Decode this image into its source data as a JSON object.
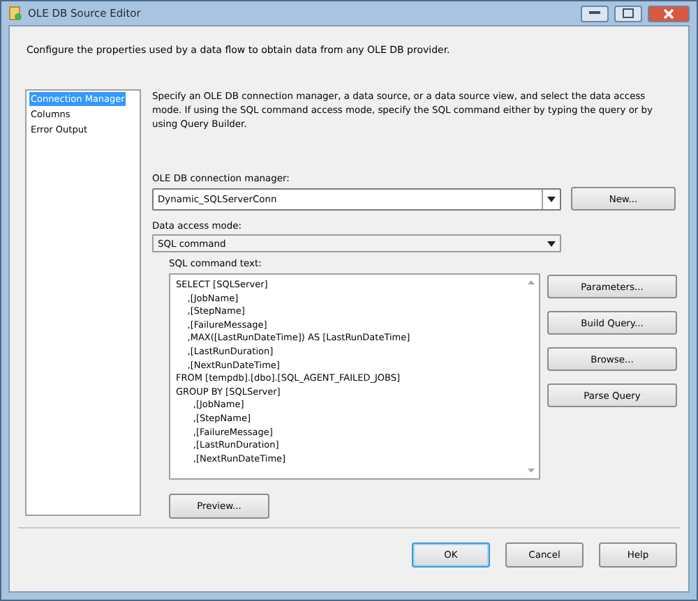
{
  "window": {
    "title": "OLE DB Source Editor"
  },
  "description": "Configure the properties used by a data flow to obtain data from any OLE DB provider.",
  "sidebar": {
    "items": [
      {
        "label": "Connection Manager",
        "selected": true
      },
      {
        "label": "Columns",
        "selected": false
      },
      {
        "label": "Error Output",
        "selected": false
      }
    ]
  },
  "page": {
    "instructions": "Specify an OLE DB connection manager, a data source, or a data source view, and select the data access mode. If using the SQL command access mode, specify the SQL command either by typing the query or by using Query Builder.",
    "connection_label": "OLE DB connection manager:",
    "connection_value": "Dynamic_SQLServerConn",
    "new_button": "New...",
    "mode_label": "Data access mode:",
    "mode_value": "SQL command",
    "sql_label": "SQL command text:",
    "sql_lines": [
      "SELECT [SQLServer]",
      "    ,[JobName]",
      "    ,[StepName]",
      "    ,[FailureMessage]",
      "    ,MAX([LastRunDateTime]) AS [LastRunDateTime]",
      "    ,[LastRunDuration]",
      "    ,[NextRunDateTime]",
      "FROM [tempdb].[dbo].[SQL_AGENT_FAILED_JOBS]",
      "GROUP BY [SQLServer]",
      "      ,[JobName]",
      "      ,[StepName]",
      "      ,[FailureMessage]",
      "      ,[LastRunDuration]",
      "      ,[NextRunDateTime]"
    ],
    "side_buttons": [
      "Parameters...",
      "Build Query...",
      "Browse...",
      "Parse Query"
    ],
    "preview_button": "Preview..."
  },
  "buttons": [
    {
      "label": "OK",
      "default": true
    },
    {
      "label": "Cancel",
      "default": false
    },
    {
      "label": "Help",
      "default": false
    }
  ]
}
